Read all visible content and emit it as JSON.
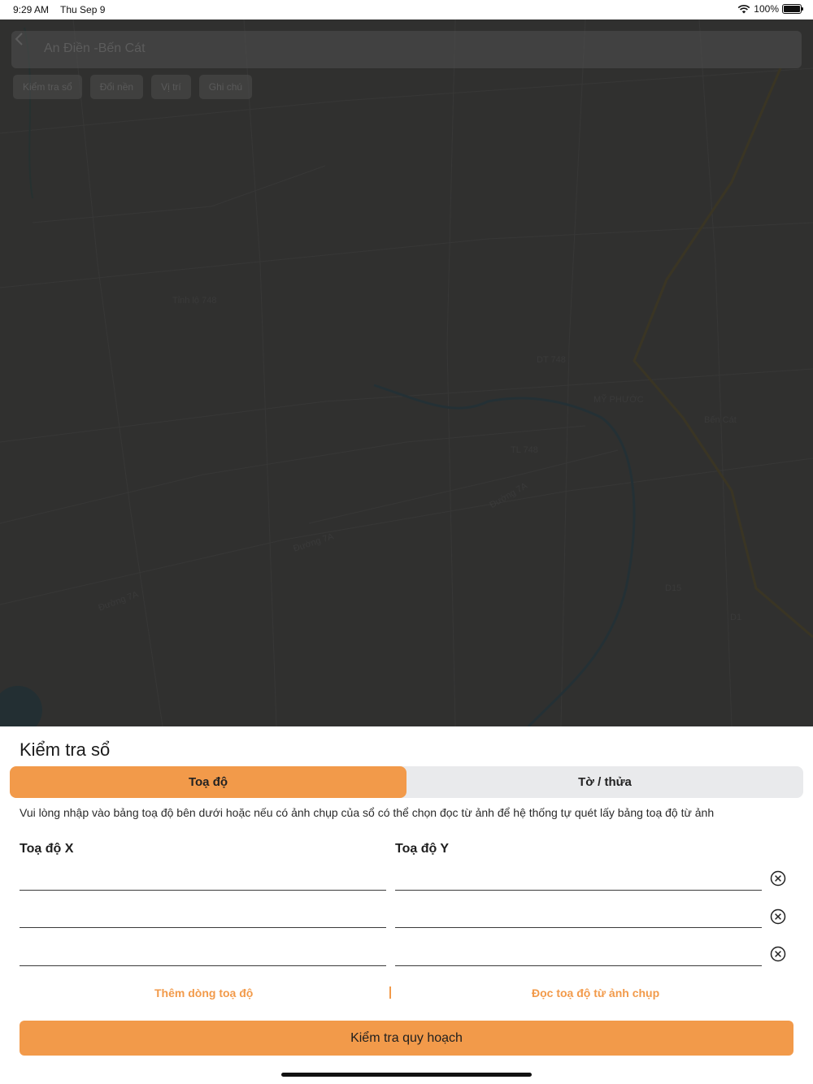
{
  "status_bar": {
    "time": "9:29 AM",
    "date": "Thu Sep 9",
    "battery": "100%"
  },
  "map": {
    "title": "An Điền -Bến Cát",
    "chips": [
      "Kiểm tra sổ",
      "Đổi nền",
      "Vị trí",
      "Ghi chú"
    ],
    "labels": [
      "Tỉnh lộ 748",
      "Đường 7A",
      "Đường 7A",
      "Đường 7A",
      "Bến Cát",
      "MỸ PHƯỚC",
      "DT 748",
      "TL 748",
      "D15",
      "D1"
    ]
  },
  "sheet": {
    "title": "Kiểm tra sổ",
    "tabs": [
      "Toạ độ",
      "Tờ / thửa"
    ],
    "active_tab": 0,
    "help_text": "Vui lòng nhập vào bảng toạ độ bên dưới hoặc nếu có ảnh chụp của sổ có thể chọn đọc từ ảnh để hệ thống tự quét lấy bảng toạ độ từ ảnh",
    "col_x": "Toạ độ X",
    "col_y": "Toạ độ Y",
    "rows": [
      {
        "x": "",
        "y": ""
      },
      {
        "x": "",
        "y": ""
      },
      {
        "x": "",
        "y": ""
      }
    ],
    "add_row": "Thêm dòng toạ độ",
    "read_from_photo": "Đọc toạ độ từ ảnh chụp",
    "submit": "Kiểm tra quy hoạch"
  },
  "colors": {
    "accent": "#f29a4a",
    "segment_bg": "#e9eaec",
    "overlay": "#2a2a2a"
  }
}
